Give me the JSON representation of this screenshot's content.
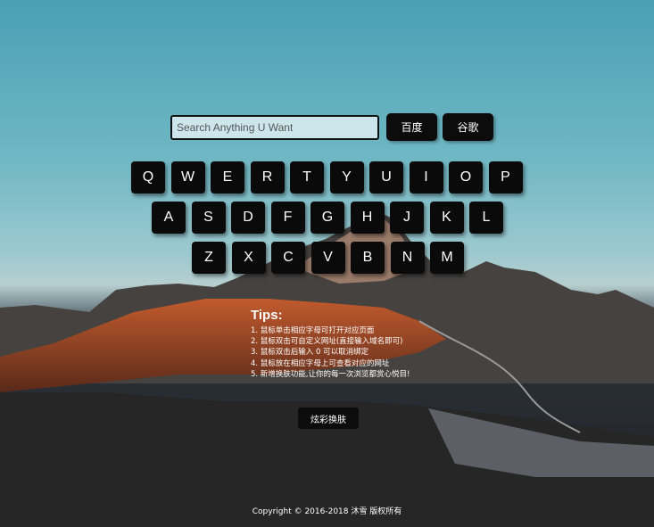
{
  "search": {
    "placeholder": "Search Anything U Want",
    "value": ""
  },
  "engines": {
    "baidu": "百度",
    "google": "谷歌"
  },
  "keyboard": {
    "row1": [
      "Q",
      "W",
      "E",
      "R",
      "T",
      "Y",
      "U",
      "I",
      "O",
      "P"
    ],
    "row2": [
      "A",
      "S",
      "D",
      "F",
      "G",
      "H",
      "J",
      "K",
      "L"
    ],
    "row3": [
      "Z",
      "X",
      "C",
      "V",
      "B",
      "N",
      "M"
    ]
  },
  "tips": {
    "title": "Tips:",
    "items": [
      "1. 鼠标单击相应字母可打开对应页面",
      "2. 鼠标双击可自定义网址(直接输入域名即可)",
      "3. 鼠标双击后输入 0 可以取消绑定",
      "4. 鼠标放在相应字母上可查看对应的网址",
      "5. 新增换肤功能,让你的每一次浏览都赏心悦目!"
    ]
  },
  "skin_button": "炫彩换肤",
  "footer": {
    "copyright": "Copyright ©  2016-2018  沐雪  版权所有"
  },
  "colors": {
    "key_bg": "#0a0a0a",
    "input_bg": "#cde6ec",
    "sky_top": "#4aa0b4"
  }
}
